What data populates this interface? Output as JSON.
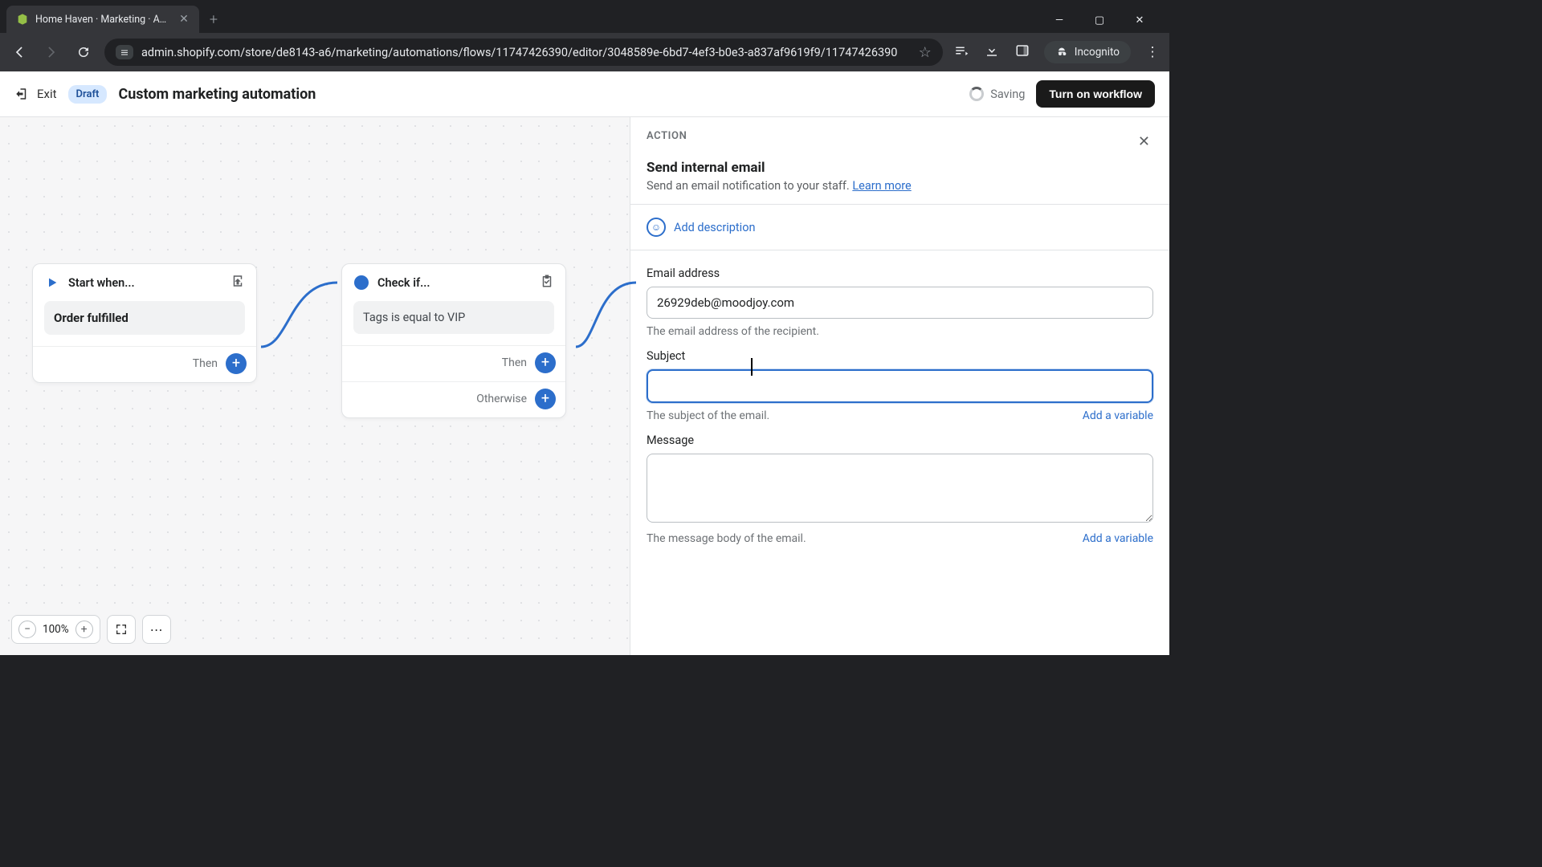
{
  "browser": {
    "tab_title": "Home Haven · Marketing · Auto",
    "url_visible": "admin.shopify.com/store/de8143-a6/marketing/automations/flows/11747426390/editor/3048589e-6bd7-4ef3-b0e3-a837af9619f9/11747426390",
    "incognito_label": "Incognito"
  },
  "header": {
    "exit_label": "Exit",
    "status_badge": "Draft",
    "title": "Custom marketing automation",
    "saving_label": "Saving",
    "primary_button": "Turn on workflow"
  },
  "canvas": {
    "start_card": {
      "header": "Start when...",
      "body": "Order fulfilled",
      "then_label": "Then"
    },
    "condition_card": {
      "header": "Check if...",
      "body": "Tags is equal to VIP",
      "then_label": "Then",
      "otherwise_label": "Otherwise"
    },
    "zoom": {
      "level": "100%"
    }
  },
  "panel": {
    "kicker": "ACTION",
    "title": "Send internal email",
    "subtitle_text": "Send an email notification to your staff.",
    "learn_more": "Learn more",
    "add_description": "Add description",
    "email": {
      "label": "Email address",
      "value": "26929deb@moodjoy.com",
      "help": "The email address of the recipient."
    },
    "subject": {
      "label": "Subject",
      "value": "",
      "help": "The subject of the email.",
      "add_variable": "Add a variable"
    },
    "message": {
      "label": "Message",
      "value": "",
      "help": "The message body of the email.",
      "add_variable": "Add a variable"
    }
  }
}
